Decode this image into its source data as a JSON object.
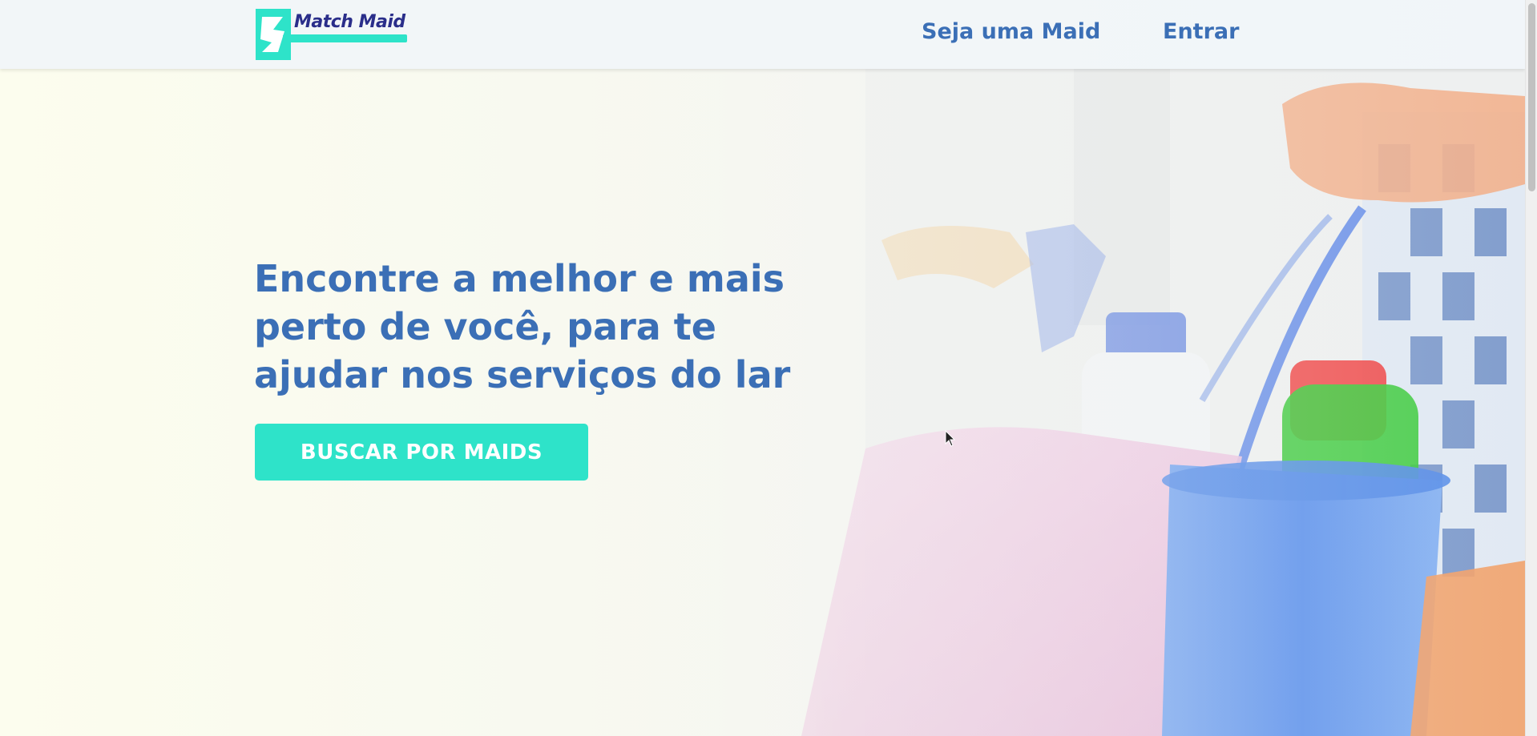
{
  "brand": {
    "logo_text": "Match Maid",
    "color_primary": "#3b6fb6",
    "color_accent": "#2ee3c9",
    "color_logo_text": "#2a2e8a"
  },
  "nav": {
    "links": [
      {
        "label": "Seja uma Maid"
      },
      {
        "label": "Entrar"
      }
    ]
  },
  "hero": {
    "headline": "Encontre a melhor e mais perto de você, para te ajudar nos serviços do lar",
    "cta_label": "BUSCAR POR MAIDS",
    "image": "cleaning-supplies-bucket-photo"
  }
}
